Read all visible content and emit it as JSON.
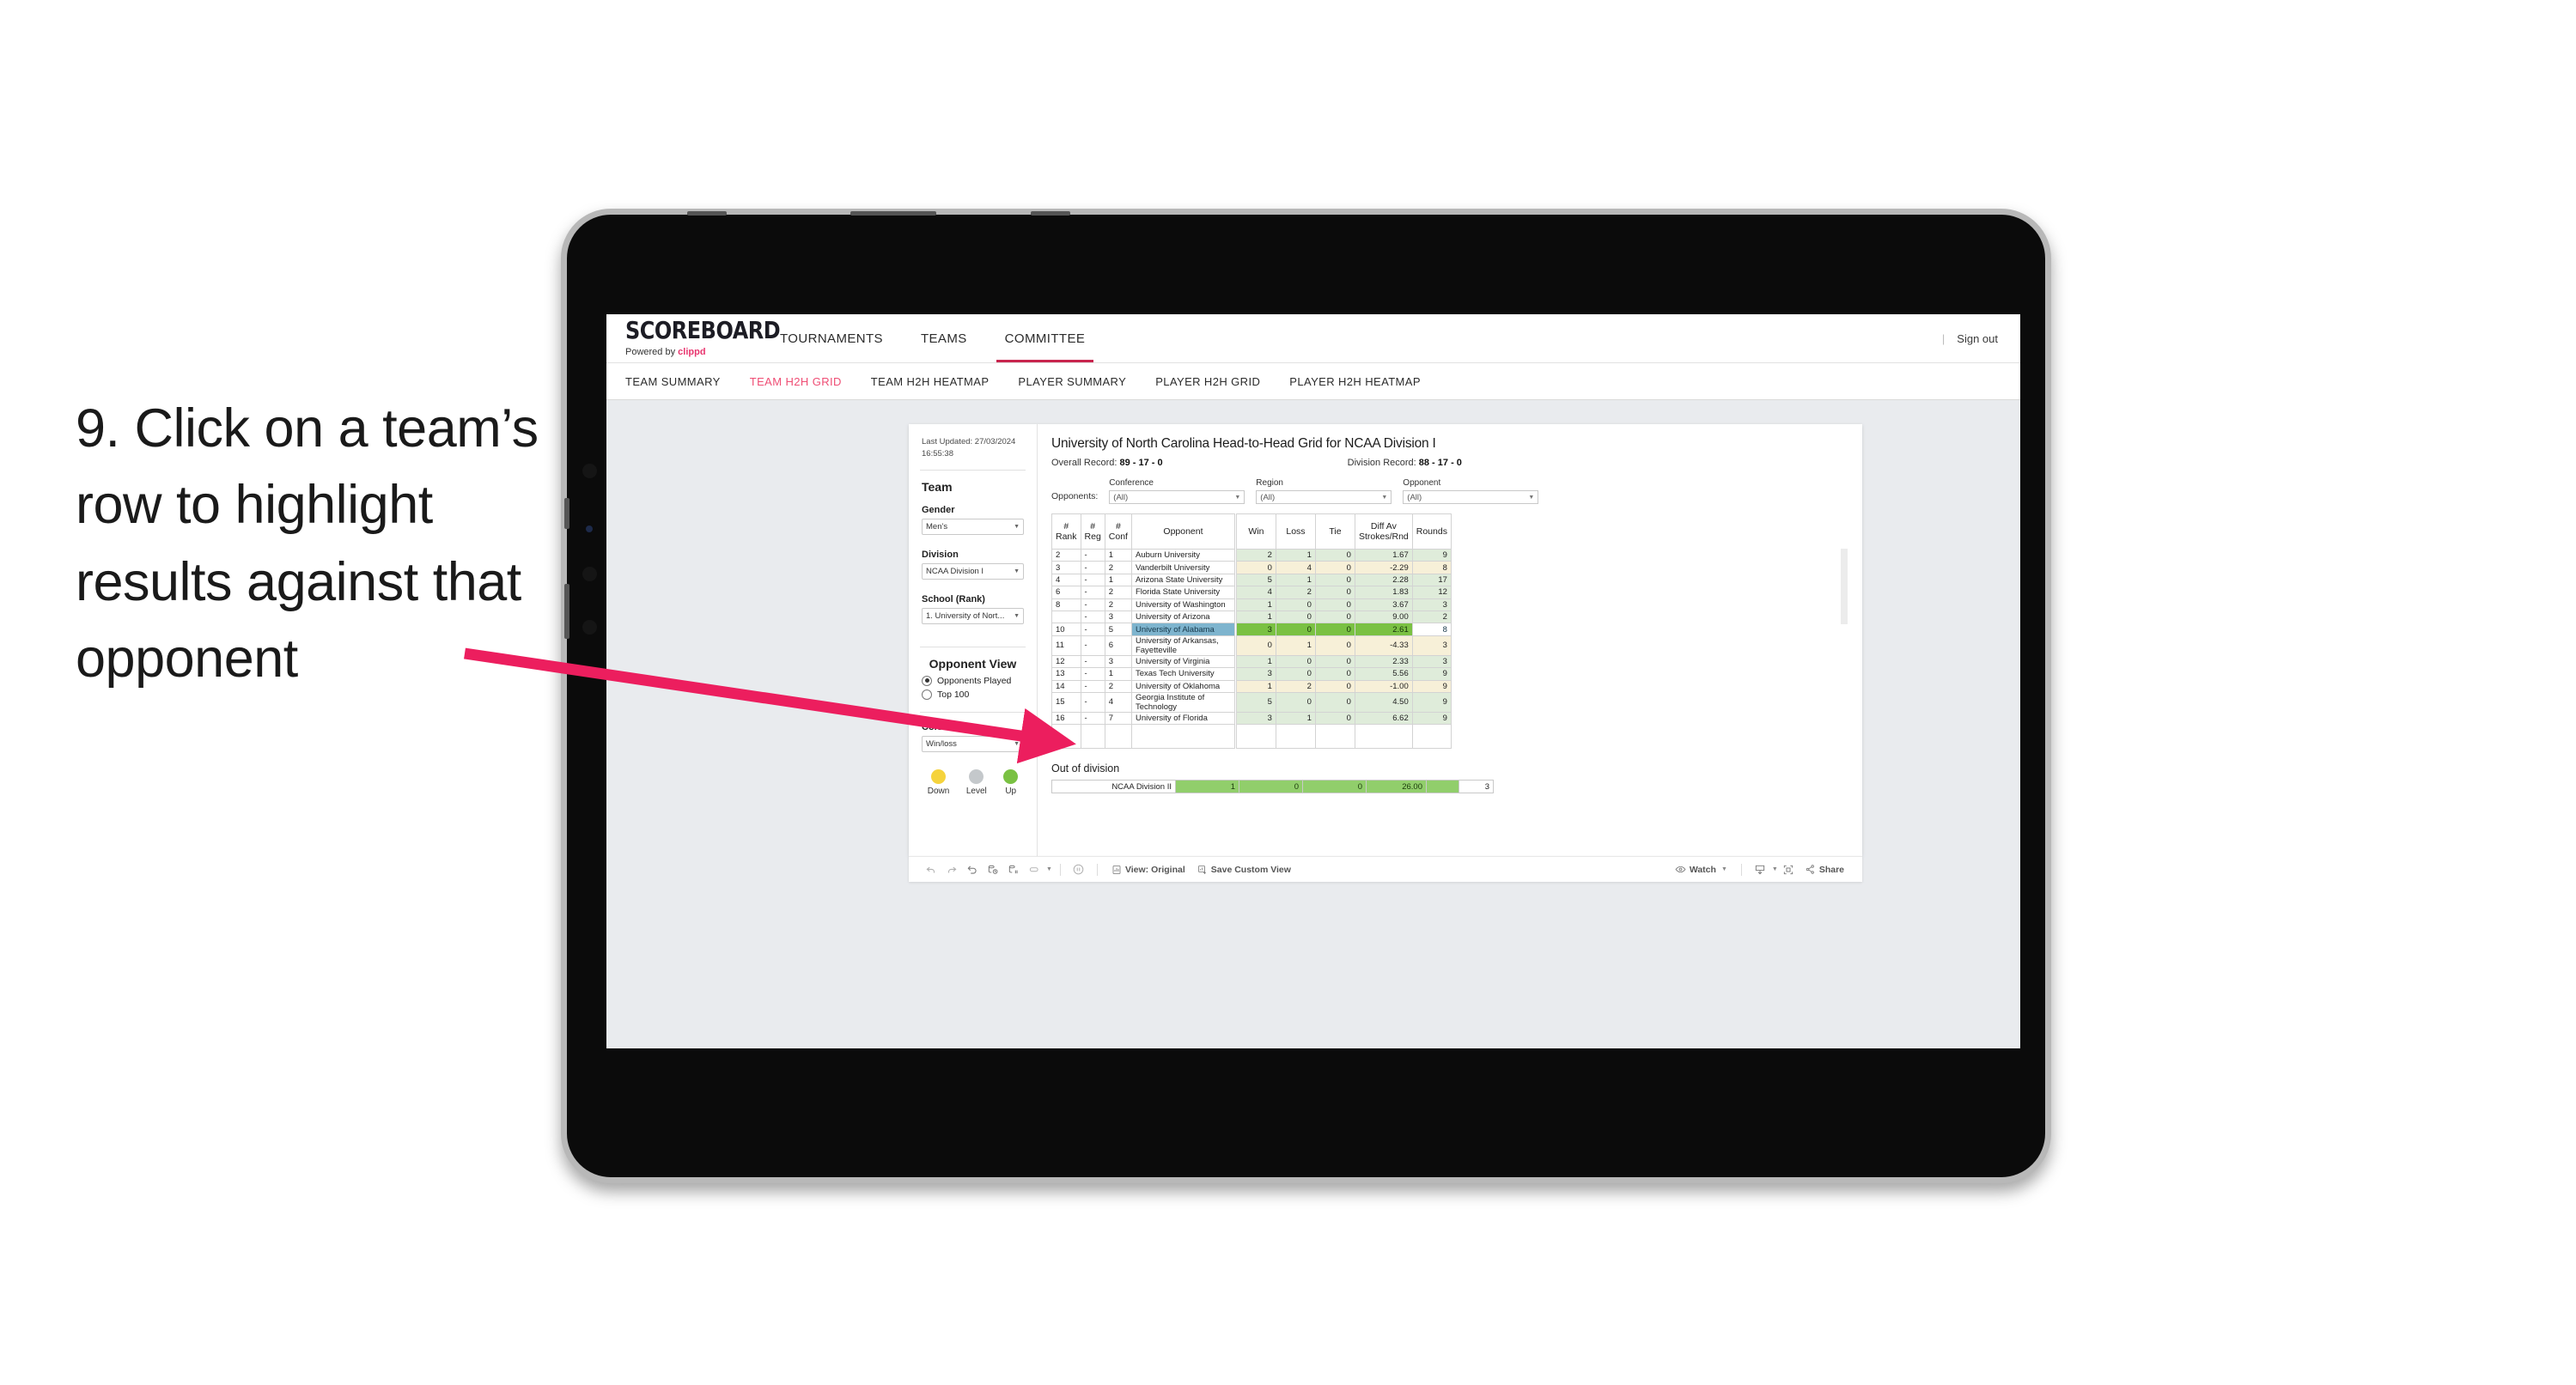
{
  "annotation": {
    "step_text": "9. Click on a team’s row to highlight results against that opponent",
    "arrow_color": "#ec1e5e"
  },
  "topnav": {
    "logo_main": "SCOREBOARD",
    "logo_sub_prefix": "Powered by ",
    "logo_sub_brand": "clippd",
    "items": [
      {
        "label": "TOURNAMENTS",
        "active": false
      },
      {
        "label": "TEAMS",
        "active": false
      },
      {
        "label": "COMMITTEE",
        "active": true
      }
    ],
    "divider": "|",
    "sign_out": "Sign out"
  },
  "subnav": {
    "items": [
      {
        "label": "TEAM SUMMARY",
        "active": false
      },
      {
        "label": "TEAM H2H GRID",
        "active": true
      },
      {
        "label": "TEAM H2H HEATMAP",
        "active": false
      },
      {
        "label": "PLAYER SUMMARY",
        "active": false
      },
      {
        "label": "PLAYER H2H GRID",
        "active": false
      },
      {
        "label": "PLAYER H2H HEATMAP",
        "active": false
      }
    ],
    "active_color": "#ef4d74"
  },
  "sidebar": {
    "last_updated": "Last Updated: 27/03/2024 16:55:38",
    "team_heading": "Team",
    "gender_label": "Gender",
    "gender_value": "Men’s",
    "division_label": "Division",
    "division_value": "NCAA Division I",
    "school_label": "School (Rank)",
    "school_value": "1. University of Nort...",
    "opponent_view_heading": "Opponent View",
    "radio_opponents_played": "Opponents Played",
    "radio_top100": "Top 100",
    "colour_by_label": "Colour by",
    "colour_by_value": "Win/loss",
    "legend": [
      {
        "label": "Down",
        "color": "#f5d33d"
      },
      {
        "label": "Level",
        "color": "#c4c8cb"
      },
      {
        "label": "Up",
        "color": "#7ac143"
      }
    ]
  },
  "main": {
    "title": "University of North Carolina Head-to-Head Grid for NCAA Division I",
    "overall_record_label": "Overall Record: ",
    "overall_record_value": "89 - 17 - 0",
    "division_record_label": "Division Record: ",
    "division_record_value": "88 - 17 - 0",
    "opponents_label": "Opponents:",
    "filters": [
      {
        "label": "Conference",
        "value": "(All)"
      },
      {
        "label": "Region",
        "value": "(All)"
      },
      {
        "label": "Opponent",
        "value": "(All)"
      }
    ]
  },
  "chart_data": {
    "type": "table",
    "title": "University of North Carolina Head-to-Head Grid for NCAA Division I",
    "columns": [
      "# Rank",
      "# Reg",
      "# Conf",
      "Opponent",
      "Win",
      "Loss",
      "Tie",
      "Diff Av Strokes/Rnd",
      "Rounds"
    ],
    "column_headers_multiline": [
      [
        "#",
        "Rank"
      ],
      [
        "#",
        "Reg"
      ],
      [
        "#",
        "Conf"
      ],
      [
        "Opponent"
      ],
      [
        "Win"
      ],
      [
        "Loss"
      ],
      [
        "Tie"
      ],
      [
        "Diff Av",
        "Strokes/Rnd"
      ],
      [
        "Rounds"
      ]
    ],
    "rows": [
      {
        "rank": "2",
        "reg": "-",
        "conf": "1",
        "opponent": "Auburn University",
        "win": "2",
        "loss": "1",
        "tie": "0",
        "diff": "1.67",
        "rounds": "9",
        "tint": "green",
        "selected": false
      },
      {
        "rank": "3",
        "reg": "-",
        "conf": "2",
        "opponent": "Vanderbilt University",
        "win": "0",
        "loss": "4",
        "tie": "0",
        "diff": "-2.29",
        "rounds": "8",
        "tint": "yellow",
        "selected": false
      },
      {
        "rank": "4",
        "reg": "-",
        "conf": "1",
        "opponent": "Arizona State University",
        "win": "5",
        "loss": "1",
        "tie": "0",
        "diff": "2.28",
        "rounds": "17",
        "tint": "green",
        "selected": false
      },
      {
        "rank": "6",
        "reg": "-",
        "conf": "2",
        "opponent": "Florida State University",
        "win": "4",
        "loss": "2",
        "tie": "0",
        "diff": "1.83",
        "rounds": "12",
        "tint": "green",
        "selected": false
      },
      {
        "rank": "8",
        "reg": "-",
        "conf": "2",
        "opponent": "University of Washington",
        "win": "1",
        "loss": "0",
        "tie": "0",
        "diff": "3.67",
        "rounds": "3",
        "tint": "green",
        "selected": false
      },
      {
        "rank": "",
        "reg": "-",
        "conf": "3",
        "opponent": "University of Arizona",
        "win": "1",
        "loss": "0",
        "tie": "0",
        "diff": "9.00",
        "rounds": "2",
        "tint": "green",
        "selected": false
      },
      {
        "rank": "10",
        "reg": "-",
        "conf": "5",
        "opponent": "University of Alabama",
        "win": "3",
        "loss": "0",
        "tie": "0",
        "diff": "2.61",
        "rounds": "8",
        "tint": "green",
        "selected": true
      },
      {
        "rank": "11",
        "reg": "-",
        "conf": "6",
        "opponent": "University of Arkansas, Fayetteville",
        "win": "0",
        "loss": "1",
        "tie": "0",
        "diff": "-4.33",
        "rounds": "3",
        "tint": "yellow",
        "selected": false
      },
      {
        "rank": "12",
        "reg": "-",
        "conf": "3",
        "opponent": "University of Virginia",
        "win": "1",
        "loss": "0",
        "tie": "0",
        "diff": "2.33",
        "rounds": "3",
        "tint": "green",
        "selected": false
      },
      {
        "rank": "13",
        "reg": "-",
        "conf": "1",
        "opponent": "Texas Tech University",
        "win": "3",
        "loss": "0",
        "tie": "0",
        "diff": "5.56",
        "rounds": "9",
        "tint": "green",
        "selected": false
      },
      {
        "rank": "14",
        "reg": "-",
        "conf": "2",
        "opponent": "University of Oklahoma",
        "win": "1",
        "loss": "2",
        "tie": "0",
        "diff": "-1.00",
        "rounds": "9",
        "tint": "yellow",
        "selected": false
      },
      {
        "rank": "15",
        "reg": "-",
        "conf": "4",
        "opponent": "Georgia Institute of Technology",
        "win": "5",
        "loss": "0",
        "tie": "0",
        "diff": "4.50",
        "rounds": "9",
        "tint": "green",
        "selected": false
      },
      {
        "rank": "16",
        "reg": "-",
        "conf": "7",
        "opponent": "University of Florida",
        "win": "3",
        "loss": "1",
        "tie": "0",
        "diff": "6.62",
        "rounds": "9",
        "tint": "green",
        "selected": false
      }
    ],
    "selected_row_opponent": "University of Alabama",
    "selected_row_color": "#7eb4ce",
    "selected_value_color": "#7ac143",
    "out_of_division": {
      "title": "Out of division",
      "label": "NCAA Division II",
      "win": "1",
      "loss": "0",
      "tie": "0",
      "diff": "26.00",
      "rounds": "3"
    }
  },
  "toolbar": {
    "view_label": "View: Original",
    "save_label": "Save Custom View",
    "watch_label": "Watch",
    "share_label": "Share"
  }
}
